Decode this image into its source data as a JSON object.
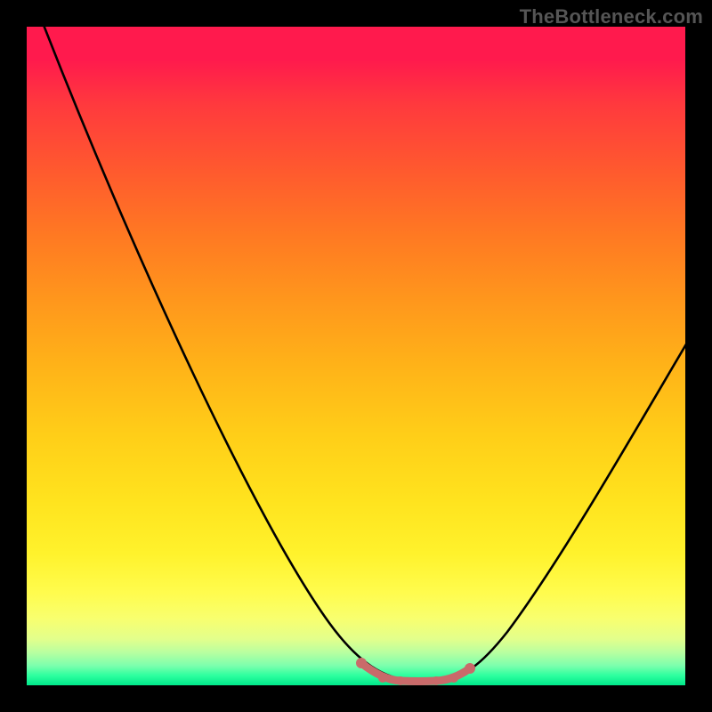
{
  "watermark": {
    "text": "TheBottleneck.com"
  },
  "chart_data": {
    "type": "line",
    "title": "",
    "xlabel": "",
    "ylabel": "",
    "xlim": [
      0,
      100
    ],
    "ylim": [
      0,
      100
    ],
    "grid": false,
    "background": "vertical gradient red→orange→yellow→green",
    "series": [
      {
        "name": "left-descending-curve",
        "x": [
          0,
          5,
          10,
          15,
          20,
          25,
          30,
          35,
          40,
          45,
          48,
          50,
          52,
          54,
          56,
          58,
          60,
          62
        ],
        "y": [
          100,
          90,
          80,
          70,
          60,
          50,
          40,
          30,
          22,
          12,
          7,
          4,
          2.5,
          1.8,
          1.4,
          1.2,
          1.1,
          1.0
        ],
        "color": "#000000"
      },
      {
        "name": "right-ascending-curve",
        "x": [
          62,
          64,
          66,
          68,
          70,
          72,
          74,
          76,
          80,
          84,
          88,
          92,
          96,
          100
        ],
        "y": [
          1.0,
          1.2,
          1.6,
          2.4,
          3.6,
          5.2,
          7.2,
          9.6,
          15.0,
          22.0,
          30.0,
          38.0,
          46.0,
          54.0
        ],
        "color": "#000000"
      },
      {
        "name": "highlighted-bottom-segment",
        "x": [
          50,
          52,
          54,
          56,
          58,
          60,
          62
        ],
        "y": [
          3.0,
          1.8,
          1.2,
          1.0,
          1.0,
          1.2,
          2.0
        ],
        "color": "#cc6666",
        "markers": true
      }
    ]
  }
}
